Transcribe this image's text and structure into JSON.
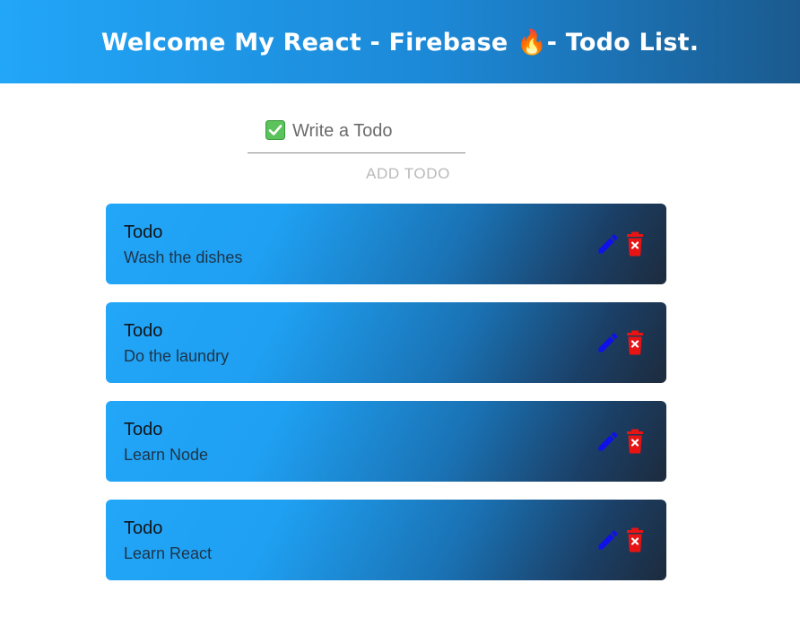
{
  "header": {
    "title": "Welcome My React - Firebase 🔥- Todo List."
  },
  "form": {
    "input_placeholder": "Write a Todo",
    "input_value": "",
    "add_button_label": "ADD TODO",
    "input_icon": "check-mark-icon"
  },
  "todos": [
    {
      "title": "Todo",
      "text": "Wash the dishes"
    },
    {
      "title": "Todo",
      "text": "Do the laundry"
    },
    {
      "title": "Todo",
      "text": "Learn Node"
    },
    {
      "title": "Todo",
      "text": "Learn React"
    }
  ],
  "colors": {
    "header_gradient_start": "#22a6f8",
    "header_gradient_end": "#1b5a8e",
    "edit_icon": "#1010e8",
    "delete_icon": "#e81414",
    "check_icon_bg": "#5cc25c"
  }
}
